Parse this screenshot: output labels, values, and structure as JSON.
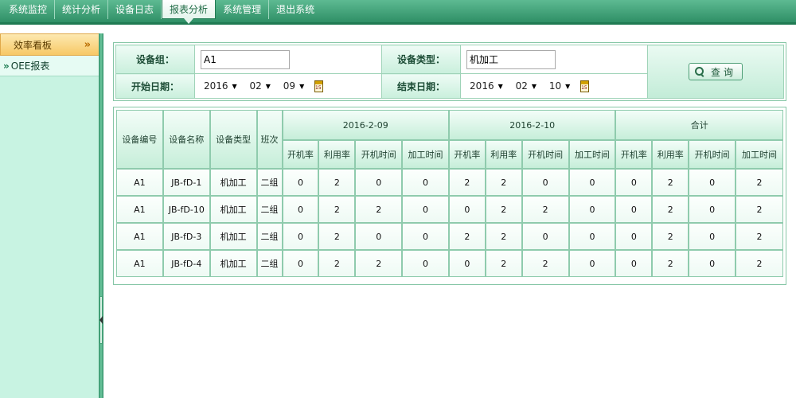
{
  "nav": {
    "items": [
      "系统监控",
      "统计分析",
      "设备日志",
      "报表分析",
      "系统管理",
      "退出系统"
    ],
    "active_index": 3
  },
  "sidebar": {
    "header": "效率看板",
    "items": [
      "OEE报表"
    ]
  },
  "filter": {
    "device_group_label": "设备组：",
    "device_group_value": "A1",
    "device_type_label": "设备类型：",
    "device_type_value": "机加工",
    "start_label": "开始日期：",
    "start": {
      "year": "2016",
      "month": "02",
      "day": "09"
    },
    "end_label": "结束日期：",
    "end": {
      "year": "2016",
      "month": "02",
      "day": "10"
    },
    "query_label": "查询"
  },
  "table": {
    "fixed_headers": [
      "设备编号",
      "设备名称",
      "设备类型",
      "班次"
    ],
    "groups": [
      "2016-2-09",
      "2016-2-10",
      "合计"
    ],
    "sub_headers": [
      "开机率",
      "利用率",
      "开机时间",
      "加工时间"
    ],
    "rows": [
      {
        "id": "A1",
        "name": "JB-fD-1",
        "type": "机加工",
        "shift": "二组",
        "values": [
          "0",
          "2",
          "0",
          "0",
          "2",
          "2",
          "0",
          "0",
          "0",
          "2",
          "0",
          "2"
        ]
      },
      {
        "id": "A1",
        "name": "JB-fD-10",
        "type": "机加工",
        "shift": "二组",
        "values": [
          "0",
          "2",
          "2",
          "0",
          "0",
          "2",
          "2",
          "0",
          "0",
          "2",
          "0",
          "2"
        ]
      },
      {
        "id": "A1",
        "name": "JB-fD-3",
        "type": "机加工",
        "shift": "二组",
        "values": [
          "0",
          "2",
          "0",
          "0",
          "2",
          "2",
          "0",
          "0",
          "0",
          "2",
          "0",
          "2"
        ]
      },
      {
        "id": "A1",
        "name": "JB-fD-4",
        "type": "机加工",
        "shift": "二组",
        "values": [
          "0",
          "2",
          "2",
          "0",
          "0",
          "2",
          "2",
          "0",
          "0",
          "2",
          "0",
          "2"
        ]
      }
    ]
  }
}
